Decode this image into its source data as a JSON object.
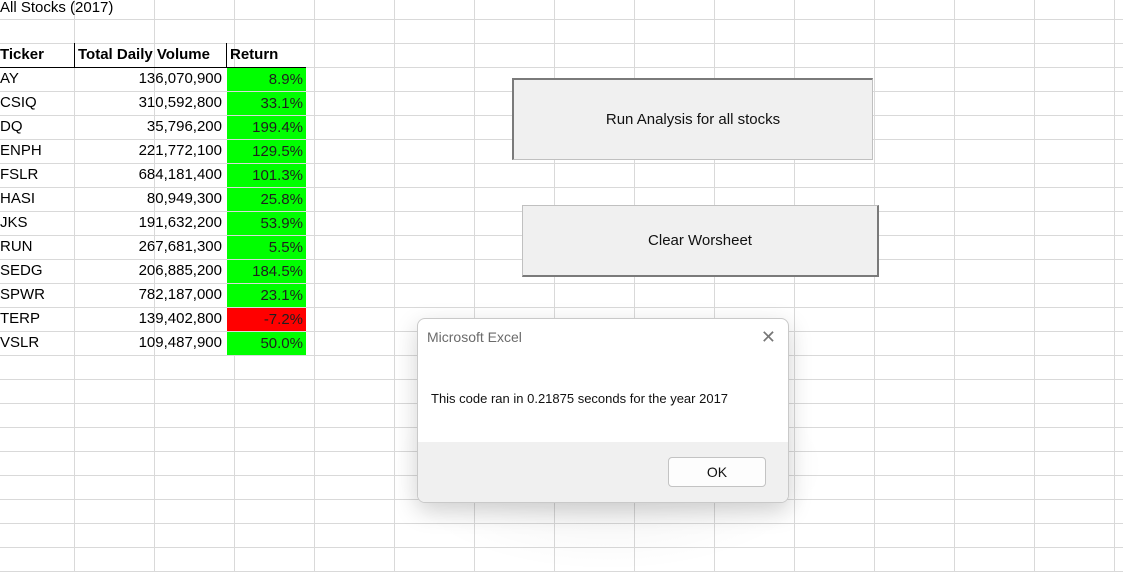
{
  "sheet": {
    "title": "All Stocks (2017)",
    "headers": {
      "ticker": "Ticker",
      "volume": "Total Daily Volume",
      "return": "Return"
    },
    "rows": [
      {
        "ticker": "AY",
        "volume": "136,070,900",
        "return": "8.9%",
        "positive": true
      },
      {
        "ticker": "CSIQ",
        "volume": "310,592,800",
        "return": "33.1%",
        "positive": true
      },
      {
        "ticker": "DQ",
        "volume": "35,796,200",
        "return": "199.4%",
        "positive": true
      },
      {
        "ticker": "ENPH",
        "volume": "221,772,100",
        "return": "129.5%",
        "positive": true
      },
      {
        "ticker": "FSLR",
        "volume": "684,181,400",
        "return": "101.3%",
        "positive": true
      },
      {
        "ticker": "HASI",
        "volume": "80,949,300",
        "return": "25.8%",
        "positive": true
      },
      {
        "ticker": "JKS",
        "volume": "191,632,200",
        "return": "53.9%",
        "positive": true
      },
      {
        "ticker": "RUN",
        "volume": "267,681,300",
        "return": "5.5%",
        "positive": true
      },
      {
        "ticker": "SEDG",
        "volume": "206,885,200",
        "return": "184.5%",
        "positive": true
      },
      {
        "ticker": "SPWR",
        "volume": "782,187,000",
        "return": "23.1%",
        "positive": true
      },
      {
        "ticker": "TERP",
        "volume": "139,402,800",
        "return": "-7.2%",
        "positive": false
      },
      {
        "ticker": "VSLR",
        "volume": "109,487,900",
        "return": "50.0%",
        "positive": true
      }
    ],
    "colors": {
      "positive": "#00ff00",
      "negative": "#ff0000",
      "gridline": "#d9d9d9"
    }
  },
  "buttons": {
    "run_label": "Run Analysis for all stocks",
    "clear_label": "Clear Worsheet"
  },
  "dialog": {
    "title": "Microsoft Excel",
    "message": "This code ran in 0.21875 seconds for the year 2017",
    "ok_label": "OK",
    "close_icon": "close-icon"
  }
}
